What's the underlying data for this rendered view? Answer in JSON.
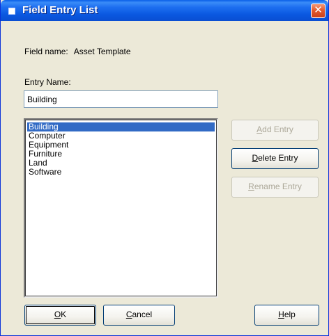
{
  "window": {
    "title": "Field Entry List",
    "close_symbol": "✕"
  },
  "field": {
    "label": "Field name:",
    "value": "Asset Template"
  },
  "entry": {
    "label": "Entry Name:",
    "value": "Building"
  },
  "list": {
    "items": [
      "Building",
      "Computer",
      "Equipment",
      "Furniture",
      "Land",
      "Software"
    ],
    "selected": "Building"
  },
  "buttons": {
    "add_prefix": "A",
    "add_rest": "dd Entry",
    "delete_prefix": "D",
    "delete_rest": "elete Entry",
    "rename_prefix": "R",
    "rename_rest": "ename Entry",
    "ok_prefix": "O",
    "ok_rest": "K",
    "cancel_prefix": "C",
    "cancel_rest": "ancel",
    "help_prefix": "H",
    "help_rest": "elp"
  },
  "colors": {
    "titlebar": "#0a58e0",
    "selection": "#316ac5",
    "dialog_bg": "#ece9d8"
  }
}
